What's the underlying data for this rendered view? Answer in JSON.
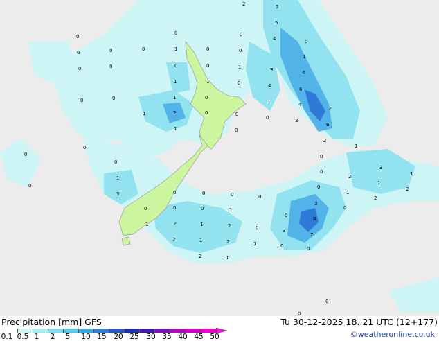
{
  "map": {
    "contour_labels": [
      "0",
      "1",
      "2",
      "3",
      "4",
      "5",
      "6",
      "7",
      "8"
    ]
  },
  "footer": {
    "left_title": "Precipitation [mm]  GFS",
    "right_title": "Tu 30-12-2025 18..21 UTC (12+177)",
    "credit": "©weatheronline.co.uk"
  },
  "legend": {
    "ticks": [
      "0.1",
      "0.5",
      "1",
      "2",
      "5",
      "10",
      "15",
      "20",
      "25",
      "30",
      "35",
      "40",
      "45",
      "50"
    ],
    "colors": [
      "#ffffff",
      "#ccf6f6",
      "#a4ecf4",
      "#7adcf0",
      "#56c8ec",
      "#3aa8e6",
      "#2c80dc",
      "#2458c8",
      "#1a2ea8",
      "#4018a8",
      "#8010b8",
      "#b008c0",
      "#d800c8",
      "#f000d0",
      "#ff00e0"
    ]
  },
  "colors": {
    "sea": "#ececec",
    "land": "#ccf5a0",
    "precip_light": "#ccf6f6",
    "precip_mid": "#8fe2f0",
    "precip_heavy": "#4aaee6",
    "precip_core": "#2a70d4"
  }
}
